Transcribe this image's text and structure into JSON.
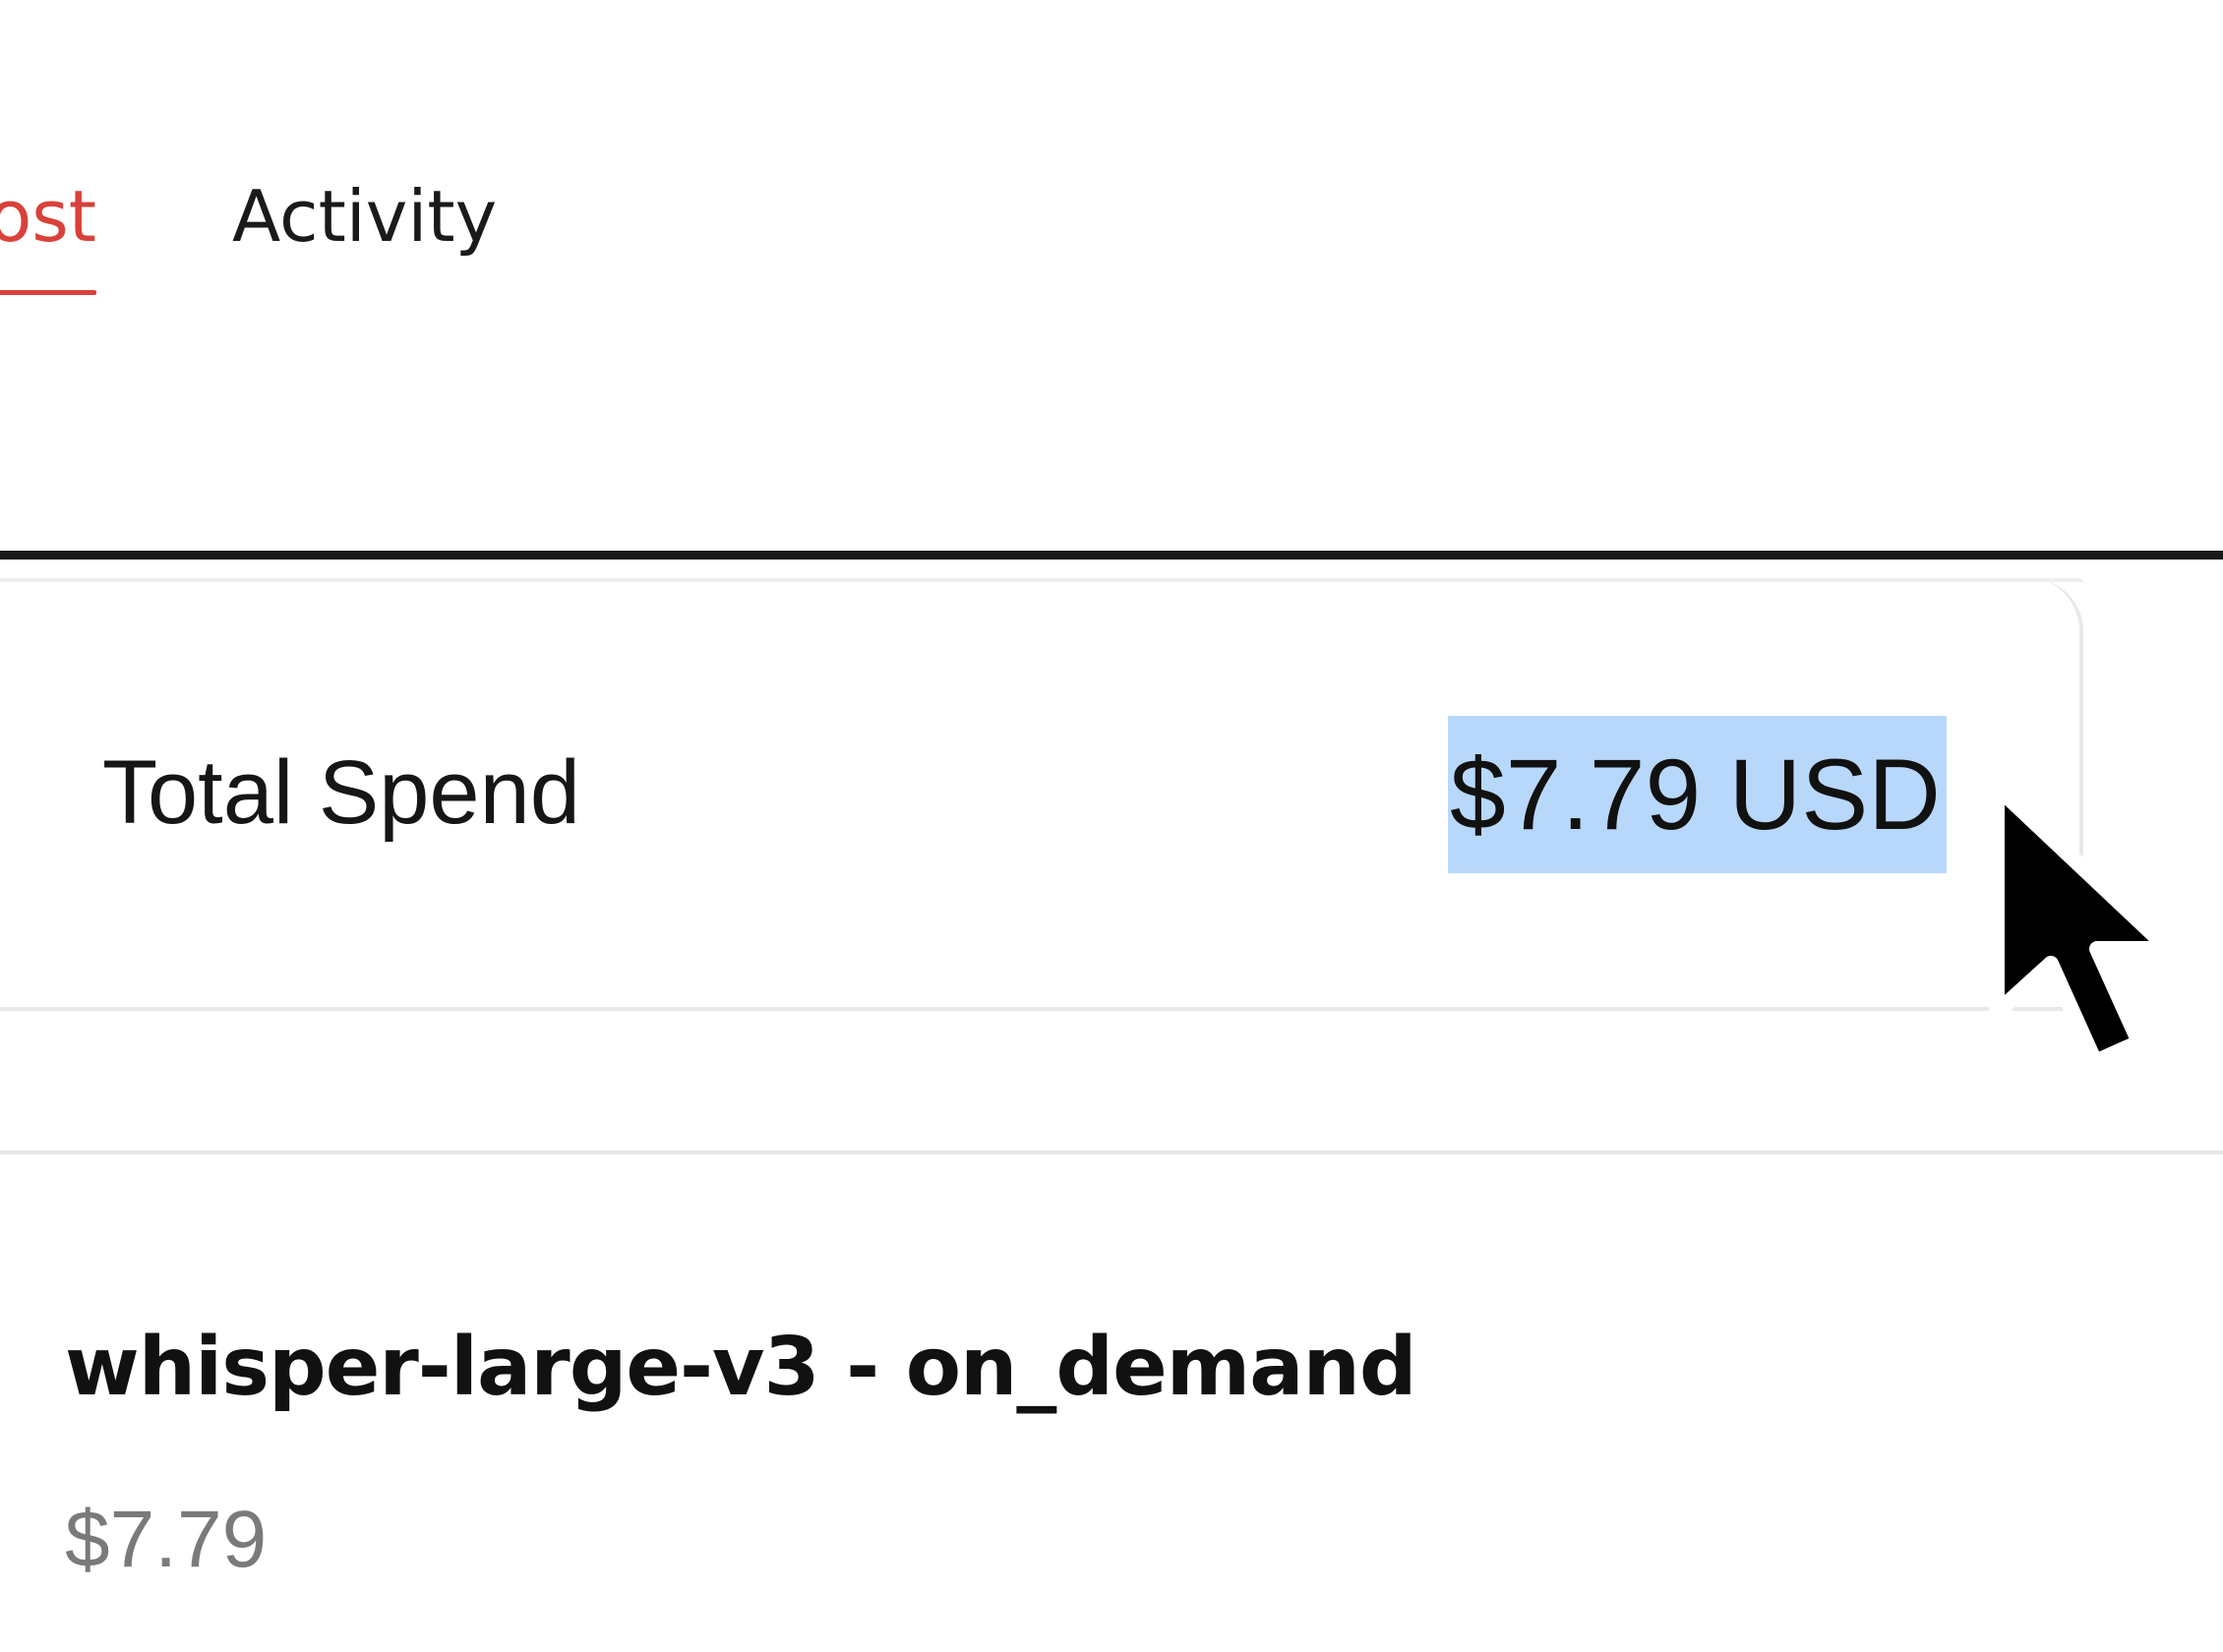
{
  "tabs": [
    {
      "label": "Cost",
      "active": true
    },
    {
      "label": "Activity",
      "active": false
    }
  ],
  "summary": {
    "label": "Total Spend",
    "value": "$7.79 USD",
    "value_selected": true
  },
  "line_items": [
    {
      "name": "whisper-large-v3 - on_demand",
      "amount": "$7.79"
    }
  ],
  "colors": {
    "active_tab": "#d9413a",
    "selection_highlight": "#b8d8fb",
    "muted_text": "#7a7a7a"
  },
  "icons": {
    "cursor": "mouse-pointer-icon"
  }
}
